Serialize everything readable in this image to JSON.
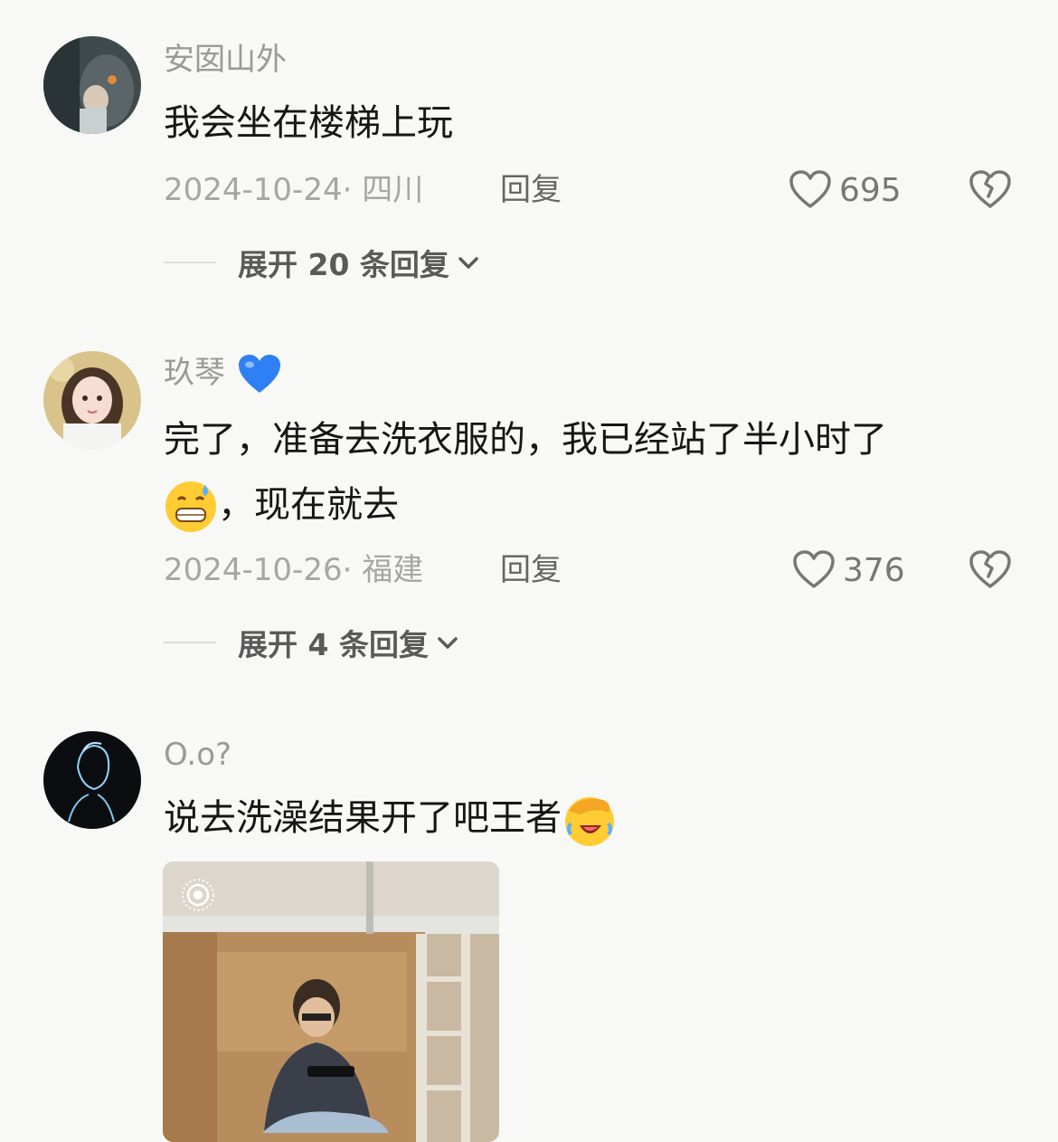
{
  "comments": [
    {
      "username": "安囡山外",
      "text": "我会坐在楼梯上玩",
      "date_location": "2024-10-24· 四川",
      "reply_label": "回复",
      "likes": "695",
      "expand_label": "展开 20 条回复"
    },
    {
      "username": "玖琴",
      "username_emoji": "blue-heart-icon",
      "text_line1": "完了，准备去洗衣服的，我已经站了半小时了",
      "text_line2_suffix": "，现在就去",
      "text_emoji": "grinning-sweat-icon",
      "date_location": "2024-10-26· 福建",
      "reply_label": "回复",
      "likes": "376",
      "expand_label": "展开 4 条回复"
    },
    {
      "username": "O.o?",
      "text": "说去洗澡结果开了吧王者",
      "text_emoji": "facepalm-laugh-icon",
      "photo_icon": "live-photo-icon"
    }
  ],
  "colors": {
    "background": "#f8f8f6",
    "blue_heart": "#2f7ff5",
    "emoji_yellow": "#ffcc33"
  }
}
